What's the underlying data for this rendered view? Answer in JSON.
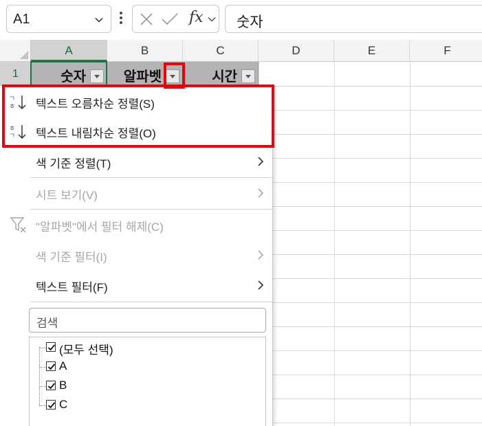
{
  "formula_bar": {
    "name_box": "A1",
    "fx_label": "fx",
    "formula_value": "숫자"
  },
  "grid": {
    "columns": [
      "A",
      "B",
      "C",
      "D",
      "E",
      "F"
    ],
    "rows": [
      "1"
    ],
    "header_cells": [
      "숫자",
      "알파벳",
      "시간"
    ]
  },
  "menu": {
    "items": [
      {
        "label": "텍스트 오름차순 정렬(S)",
        "enabled": true
      },
      {
        "label": "텍스트 내림차순 정렬(O)",
        "enabled": true
      },
      {
        "label": "색 기준 정렬(T)",
        "enabled": true,
        "submenu": true
      },
      {
        "label": "시트 보기(V)",
        "enabled": false,
        "submenu": true
      },
      {
        "label": "\"알파벳\"에서 필터 해제(C)",
        "enabled": false
      },
      {
        "label": "색 기준 필터(I)",
        "enabled": false,
        "submenu": true
      },
      {
        "label": "텍스트 필터(F)",
        "enabled": true,
        "submenu": true
      }
    ],
    "search_placeholder": "검색",
    "values": [
      {
        "label": "(모두 선택)",
        "checked": true
      },
      {
        "label": "A",
        "checked": true
      },
      {
        "label": "B",
        "checked": true
      },
      {
        "label": "C",
        "checked": true
      }
    ]
  },
  "colors": {
    "highlight": "#e8000b",
    "excel_green": "#217346",
    "header_fill": "#b4b4b4"
  },
  "icons": [
    "chevron-down-icon",
    "cancel-icon",
    "enter-icon",
    "sort-ascending-icon",
    "sort-descending-icon",
    "clear-filter-icon",
    "chevron-right-icon",
    "checkbox-checked-icon",
    "filter-dropdown-icon"
  ]
}
